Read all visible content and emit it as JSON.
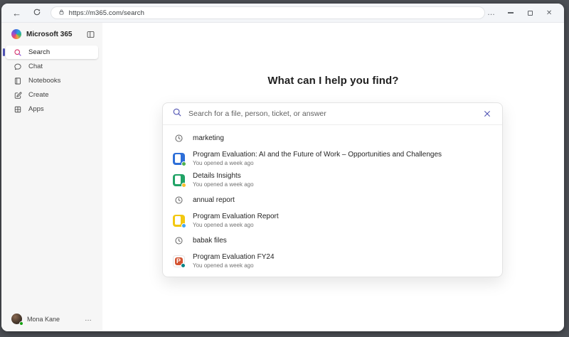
{
  "browser": {
    "url": "https://m365.com/search"
  },
  "sidebar": {
    "app_title": "Microsoft 365",
    "items": [
      {
        "label": "Search",
        "selected": true
      },
      {
        "label": "Chat",
        "selected": false
      },
      {
        "label": "Notebooks",
        "selected": false
      },
      {
        "label": "Create",
        "selected": false
      },
      {
        "label": "Apps",
        "selected": false
      }
    ],
    "user": {
      "name": "Mona Kane"
    }
  },
  "main": {
    "heading": "What can I help you find?",
    "search": {
      "placeholder": "Search for a file, person, ticket, or answer"
    },
    "suggestions": [
      {
        "type": "query",
        "label": "marketing"
      },
      {
        "type": "file",
        "app": "word",
        "title": "Program Evaluation: AI and the Future of Work – Opportunities and Challenges",
        "meta": "You opened a week ago"
      },
      {
        "type": "file",
        "app": "excel",
        "title": "Details Insights",
        "meta": "You opened a week ago"
      },
      {
        "type": "query",
        "label": "annual report"
      },
      {
        "type": "file",
        "app": "report",
        "title": "Program Evaluation Report",
        "meta": "You opened a week ago"
      },
      {
        "type": "query",
        "label": "babak files"
      },
      {
        "type": "file",
        "app": "powerpoint",
        "title": "Program Evaluation FY24",
        "meta": "You opened a week ago"
      }
    ]
  },
  "icons": {
    "powerpoint_glyph": "P"
  },
  "colors": {
    "accent": "#4f52b2",
    "word": "#2e6fd8",
    "excel": "#21a366",
    "report": "#f2c811",
    "powerpoint": "#d35230"
  }
}
